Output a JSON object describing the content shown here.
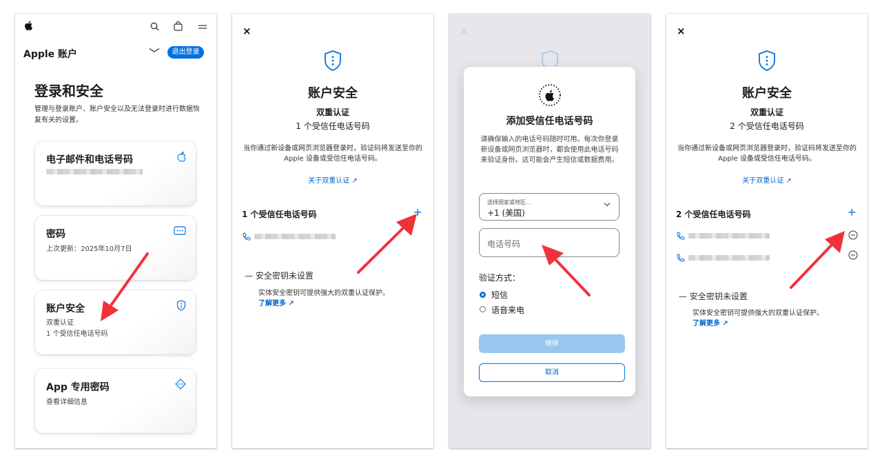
{
  "colors": {
    "accent": "#0071e3",
    "link": "#0066cc",
    "arrow": "#f0313a",
    "disabled_button": "#99c6ef"
  },
  "panel1": {
    "icons": [
      "apple-logo-icon",
      "search-icon",
      "bag-icon",
      "menu-icon"
    ],
    "account_title": "Apple 账户",
    "logout_label": "退出登录",
    "heading": "登录和安全",
    "description": "管理与登录账户、账户安全以及无法登录时进行数据恢复有关的设置。",
    "cards": [
      {
        "title": "电子邮件和电话号码",
        "icon": "apple-logo-icon"
      },
      {
        "title": "密码",
        "line1": "上次更新：2025年10月7日",
        "icon": "password-dots-icon"
      },
      {
        "title": "账户安全",
        "line1": "双重认证",
        "line2": "1 个受信任电话号码",
        "icon": "shield-icon"
      },
      {
        "title": "App 专用密码",
        "line1": "查看详细信息",
        "icon": "diamond-dots-icon"
      }
    ]
  },
  "panel2": {
    "close": "×",
    "title": "账户安全",
    "subtitle1": "双重认证",
    "subtitle2": "1 个受信任电话号码",
    "paragraph": "当你通过新设备或网页浏览器登录时，验证码将发送至你的 Apple 设备或受信任电话号码。",
    "about_link": "关于双重认证 ↗",
    "section_title": "1 个受信任电话号码",
    "add": "+",
    "security_key_status": "—  安全密钥未设置",
    "security_key_desc": "实体安全密钥可提供强大的双重认证保护。",
    "learn_more": "了解更多 ↗"
  },
  "panel3": {
    "close": "×",
    "modal_title": "添加受信任电话号码",
    "modal_paragraph": "请确保输入的电话号码随时可用。每次你登录新设备或网页浏览器时，都会使用此电话号码来验证身份。这可能会产生短信或数据费用。",
    "country_label": "选择国家或地区...",
    "country_value": "+1 (美国)",
    "phone_placeholder": "电话号码",
    "verify_label": "验证方式：",
    "options": [
      "短信",
      "语音来电"
    ],
    "selected_option": "短信",
    "continue_label": "继续",
    "cancel_label": "取消"
  },
  "panel4": {
    "close": "×",
    "title": "账户安全",
    "subtitle1": "双重认证",
    "subtitle2": "2 个受信任电话号码",
    "paragraph": "当你通过新设备或网页浏览器登录时，验证码将发送至你的 Apple 设备或受信任电话号码。",
    "about_link": "关于双重认证 ↗",
    "section_title": "2 个受信任电话号码",
    "add": "+",
    "security_key_status": "—  安全密钥未设置",
    "security_key_desc": "实体安全密钥可提供强大的双重认证保护。",
    "learn_more": "了解更多 ↗"
  }
}
